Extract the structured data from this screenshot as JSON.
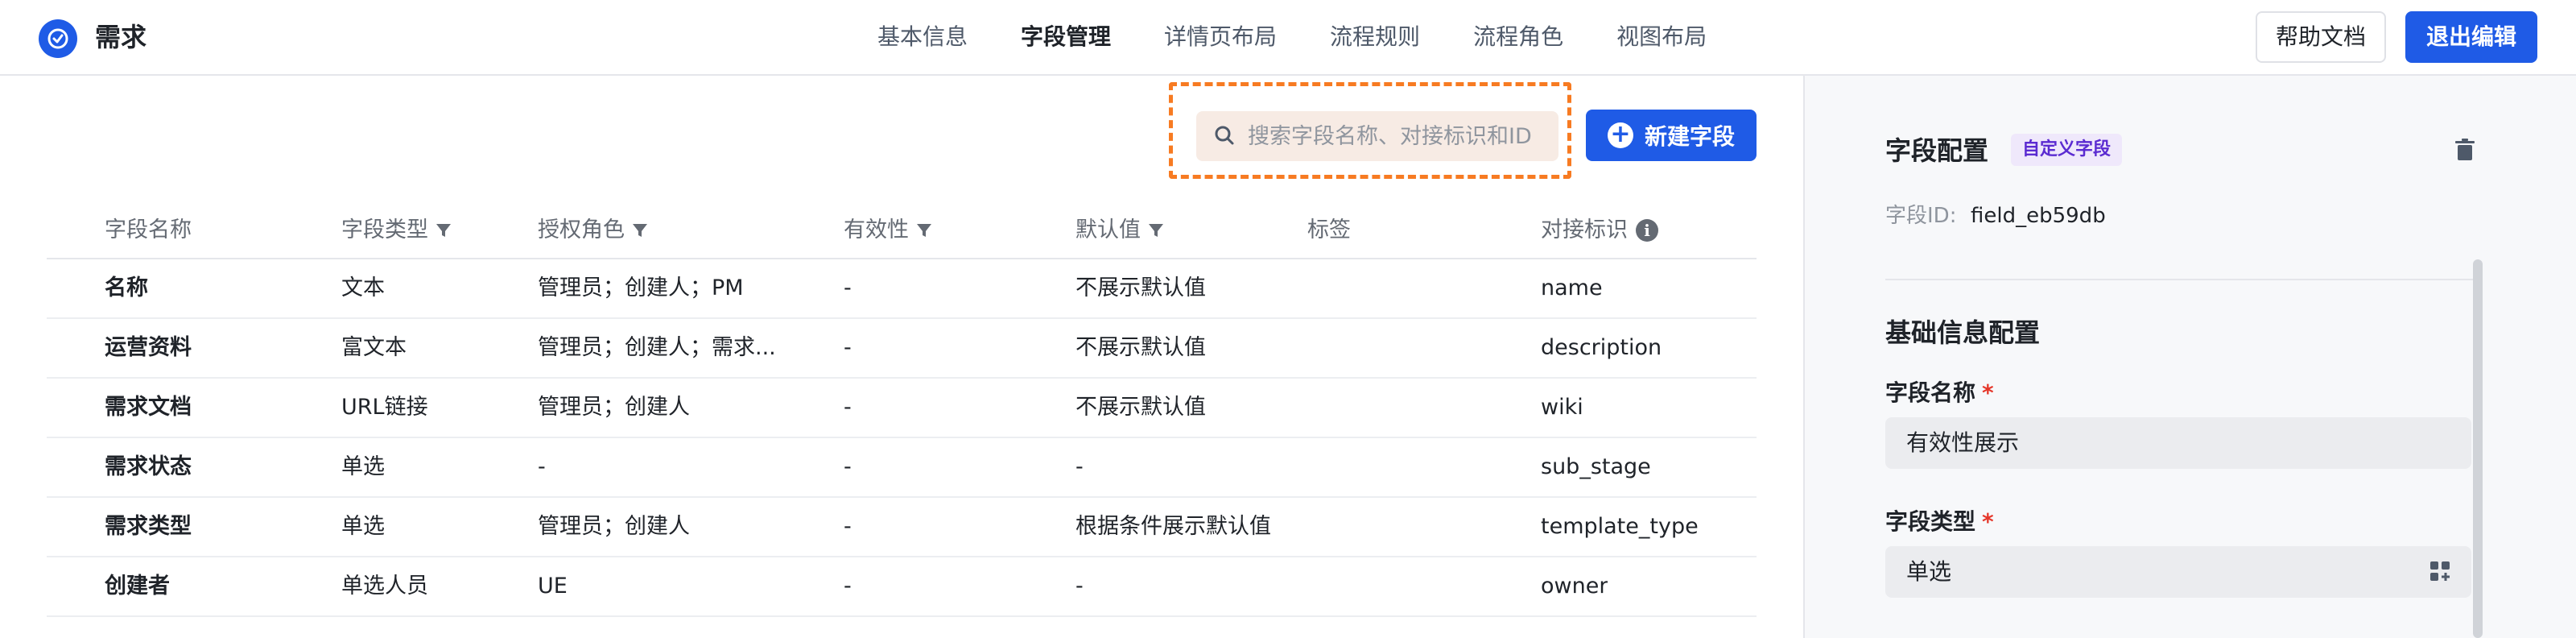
{
  "app": {
    "title": "需求"
  },
  "nav": {
    "tabs": [
      {
        "label": "基本信息",
        "active": false
      },
      {
        "label": "字段管理",
        "active": true
      },
      {
        "label": "详情页布局",
        "active": false
      },
      {
        "label": "流程规则",
        "active": false
      },
      {
        "label": "流程角色",
        "active": false
      },
      {
        "label": "视图布局",
        "active": false
      }
    ]
  },
  "header": {
    "help_label": "帮助文档",
    "exit_label": "退出编辑"
  },
  "toolbar": {
    "search_placeholder": "搜索字段名称、对接标识和ID",
    "search_value": "",
    "new_field_label": "新建字段"
  },
  "table": {
    "columns": [
      "字段名称",
      "字段类型",
      "授权角色",
      "有效性",
      "默认值",
      "标签",
      "对接标识"
    ],
    "rows": [
      [
        "名称",
        "文本",
        "管理员；创建人；PM",
        "-",
        "不展示默认值",
        "",
        "name"
      ],
      [
        "运营资料",
        "富文本",
        "管理员；创建人；需求...",
        "-",
        "不展示默认值",
        "",
        "description"
      ],
      [
        "需求文档",
        "URL链接",
        "管理员；创建人",
        "-",
        "不展示默认值",
        "",
        "wiki"
      ],
      [
        "需求状态",
        "单选",
        "-",
        "-",
        "-",
        "",
        "sub_stage"
      ],
      [
        "需求类型",
        "单选",
        "管理员；创建人",
        "-",
        "根据条件展示默认值",
        "",
        "template_type"
      ],
      [
        "创建者",
        "单选人员",
        "UE",
        "-",
        "-",
        "",
        "owner"
      ]
    ]
  },
  "side_panel": {
    "title": "字段配置",
    "tag": "自定义字段",
    "field_id_label": "字段ID:",
    "field_id_value": "field_eb59db",
    "section_title": "基础信息配置",
    "field_name_label": "字段名称",
    "field_name_value": "有效性展示",
    "field_type_label": "字段类型",
    "field_type_value": "单选",
    "required_mark": "*"
  },
  "colors": {
    "accent": "#1f5be6",
    "highlight_border": "#f77b22",
    "tag_bg": "#efe8fb",
    "tag_text": "#5b2bd1"
  },
  "icons": {
    "logo": "check-circle-icon",
    "search": "search-icon",
    "add": "plus-circle-icon",
    "filter": "filter-icon",
    "info": "info-icon",
    "delete": "trash-icon",
    "type_select": "grid-add-icon"
  }
}
